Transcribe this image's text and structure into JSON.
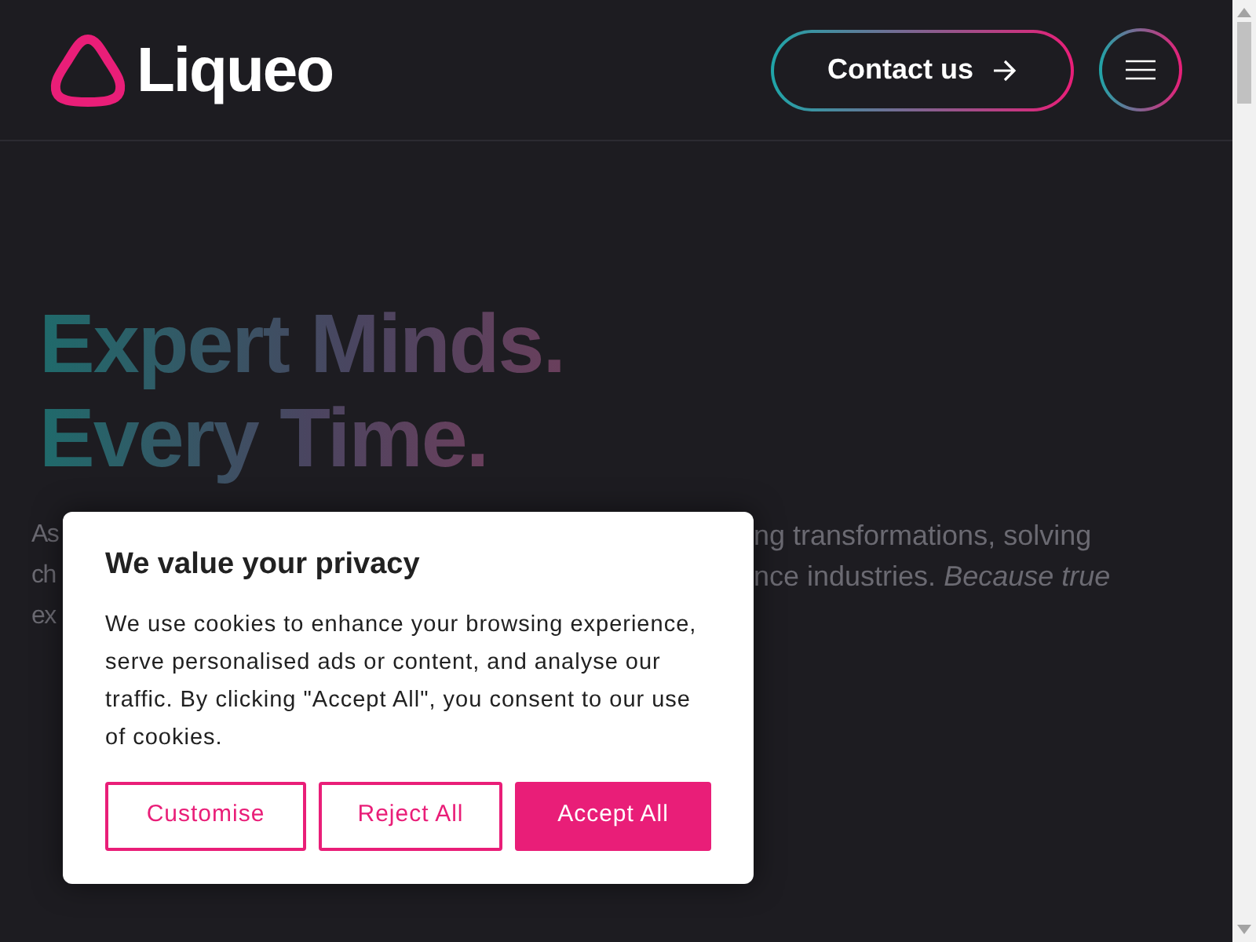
{
  "header": {
    "logo_text": "Liqueo",
    "contact_button": {
      "label": "Contact us"
    }
  },
  "hero": {
    "title_lines": [
      "Expert Minds.",
      "Every Time."
    ],
    "paragraph_lines": [
      {
        "left": "As",
        "right": "ng transformations, solving"
      },
      {
        "left": "ch",
        "right": "nce industries. *Because true*"
      },
      {
        "left": "ex"
      }
    ]
  },
  "cookie_dialog": {
    "title": "We value your privacy",
    "body": "We use cookies to enhance your browsing experience, serve personalised ads or content, and analyse our traffic. By clicking \"Accept All\", you consent to our use of cookies.",
    "buttons": [
      {
        "label": "Customise",
        "kind": "outline"
      },
      {
        "label": "Reject All",
        "kind": "outline"
      },
      {
        "label": "Accept All",
        "kind": "filled"
      }
    ]
  }
}
